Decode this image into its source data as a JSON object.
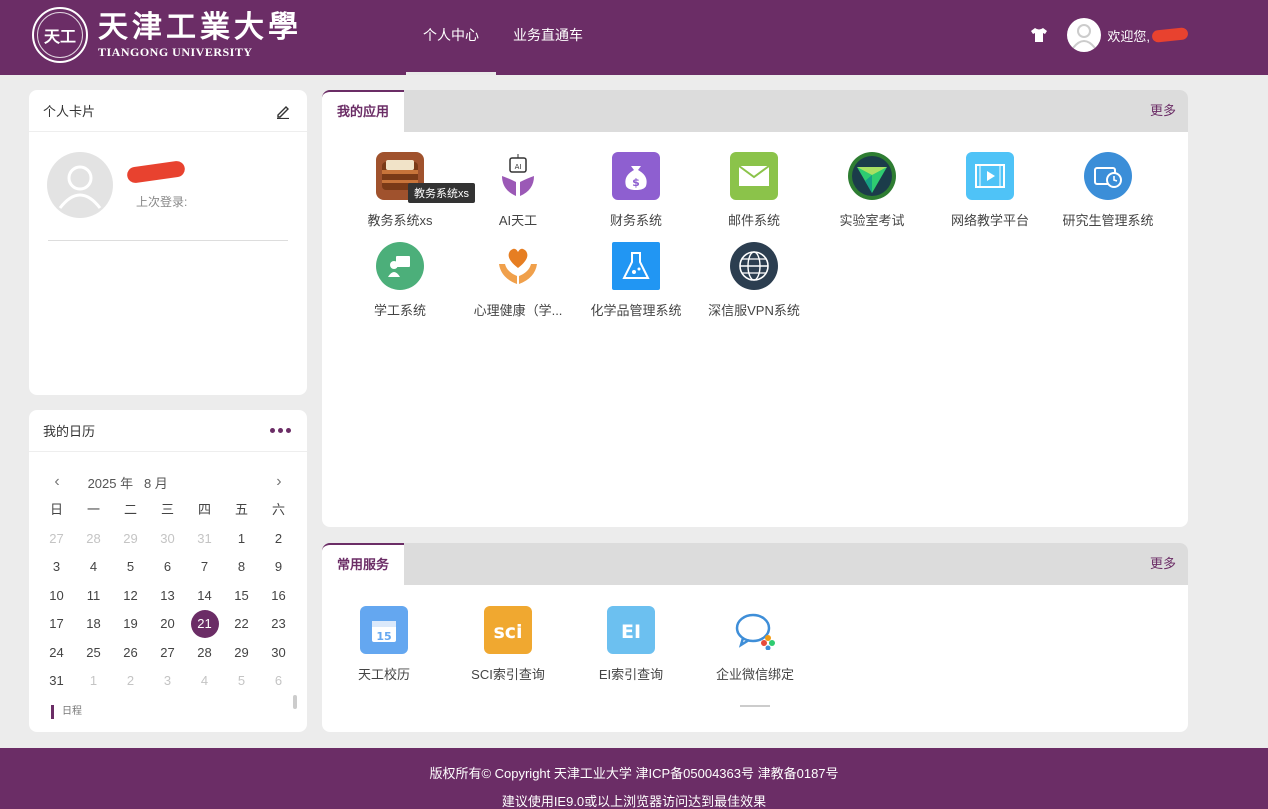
{
  "header": {
    "seal_text": "天工",
    "logo_cn": "天津工業大學",
    "logo_en": "TIANGONG UNIVERSITY",
    "nav": [
      "个人中心",
      "业务直通车"
    ],
    "welcome": "欢迎您,"
  },
  "profile": {
    "title": "个人卡片",
    "last_login": "上次登录:"
  },
  "calendar": {
    "title": "我的日历",
    "year_label": "2025 年",
    "month_label": "8 月",
    "weekdays": [
      "日",
      "一",
      "二",
      "三",
      "四",
      "五",
      "六"
    ],
    "days": [
      [
        "27",
        "28",
        "29",
        "30",
        "31",
        "1",
        "2"
      ],
      [
        "3",
        "4",
        "5",
        "6",
        "7",
        "8",
        "9"
      ],
      [
        "10",
        "11",
        "12",
        "13",
        "14",
        "15",
        "16"
      ],
      [
        "17",
        "18",
        "19",
        "20",
        "21",
        "22",
        "23"
      ],
      [
        "24",
        "25",
        "26",
        "27",
        "28",
        "29",
        "30"
      ],
      [
        "31",
        "1",
        "2",
        "3",
        "4",
        "5",
        "6"
      ]
    ],
    "today": "21",
    "schedule_label": "日程"
  },
  "apps_panel": {
    "tab": "我的应用",
    "more": "更多",
    "tooltip": "教务系统xs",
    "items": [
      {
        "label": "教务系统xs",
        "icon": "wallet-icon"
      },
      {
        "label": "AI天工",
        "icon": "ai-chip-icon"
      },
      {
        "label": "财务系统",
        "icon": "money-bag-icon"
      },
      {
        "label": "邮件系统",
        "icon": "mail-icon"
      },
      {
        "label": "实验室考试",
        "icon": "lab-exam-icon"
      },
      {
        "label": "网络教学平台",
        "icon": "video-icon"
      },
      {
        "label": "研究生管理系统",
        "icon": "wallet-clock-icon"
      },
      {
        "label": "学工系统",
        "icon": "student-icon"
      },
      {
        "label": "心理健康（学...",
        "icon": "heart-hands-icon"
      },
      {
        "label": "化学品管理系统",
        "icon": "flask-icon"
      },
      {
        "label": "深信服VPN系统",
        "icon": "globe-icon"
      }
    ]
  },
  "services_panel": {
    "tab": "常用服务",
    "more": "更多",
    "items": [
      {
        "label": "天工校历",
        "icon": "calendar-icon"
      },
      {
        "label": "SCI索引查询",
        "icon": "sci-icon"
      },
      {
        "label": "EI索引查询",
        "icon": "ei-icon"
      },
      {
        "label": "企业微信绑定",
        "icon": "wecom-icon"
      }
    ]
  },
  "footer": {
    "line1": "版权所有© Copyright 天津工业大学 津ICP备05004363号 津教备0187号",
    "line2": "建议使用IE9.0或以上浏览器访问达到最佳效果"
  },
  "colors": {
    "brand": "#6b2d66",
    "background": "#ececec",
    "redaction": "#e8422f"
  }
}
